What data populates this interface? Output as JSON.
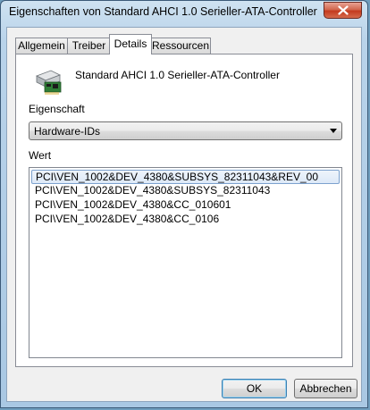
{
  "window": {
    "title": "Eigenschaften von Standard AHCI 1.0 Serieller-ATA-Controller"
  },
  "tabs": [
    {
      "label": "Allgemein"
    },
    {
      "label": "Treiber"
    },
    {
      "label": "Details"
    },
    {
      "label": "Ressourcen"
    }
  ],
  "active_tab": "Details",
  "device": {
    "name": "Standard AHCI 1.0 Serieller-ATA-Controller",
    "icon": "storage-controller-icon"
  },
  "property": {
    "label": "Eigenschaft",
    "selected": "Hardware-IDs"
  },
  "value": {
    "label": "Wert",
    "items": [
      "PCI\\VEN_1002&DEV_4380&SUBSYS_82311043&REV_00",
      "PCI\\VEN_1002&DEV_4380&SUBSYS_82311043",
      "PCI\\VEN_1002&DEV_4380&CC_010601",
      "PCI\\VEN_1002&DEV_4380&CC_0106"
    ]
  },
  "buttons": {
    "ok": "OK",
    "cancel": "Abbrechen"
  }
}
